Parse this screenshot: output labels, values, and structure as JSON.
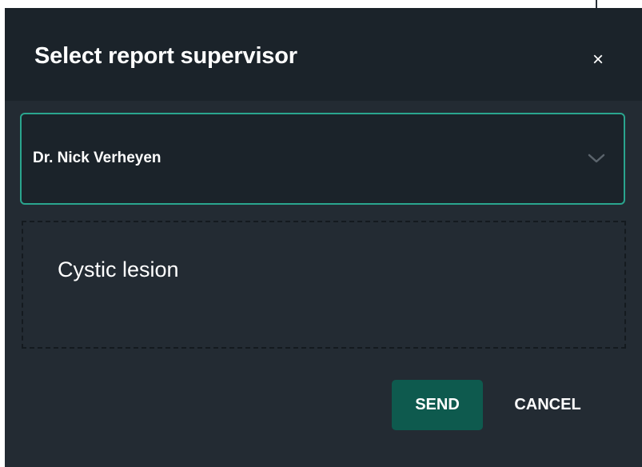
{
  "dialog": {
    "title": "Select report supervisor",
    "close_icon": "close-icon",
    "close_glyph": "×"
  },
  "supervisor_select": {
    "selected_value": "Dr. Nick Verheyen",
    "icon": "chevron-down-icon",
    "border_color": "#2aa58e"
  },
  "note": {
    "text": "Cystic lesion"
  },
  "actions": {
    "send_label": "SEND",
    "cancel_label": "CANCEL",
    "send_color": "#0e5a4e"
  }
}
